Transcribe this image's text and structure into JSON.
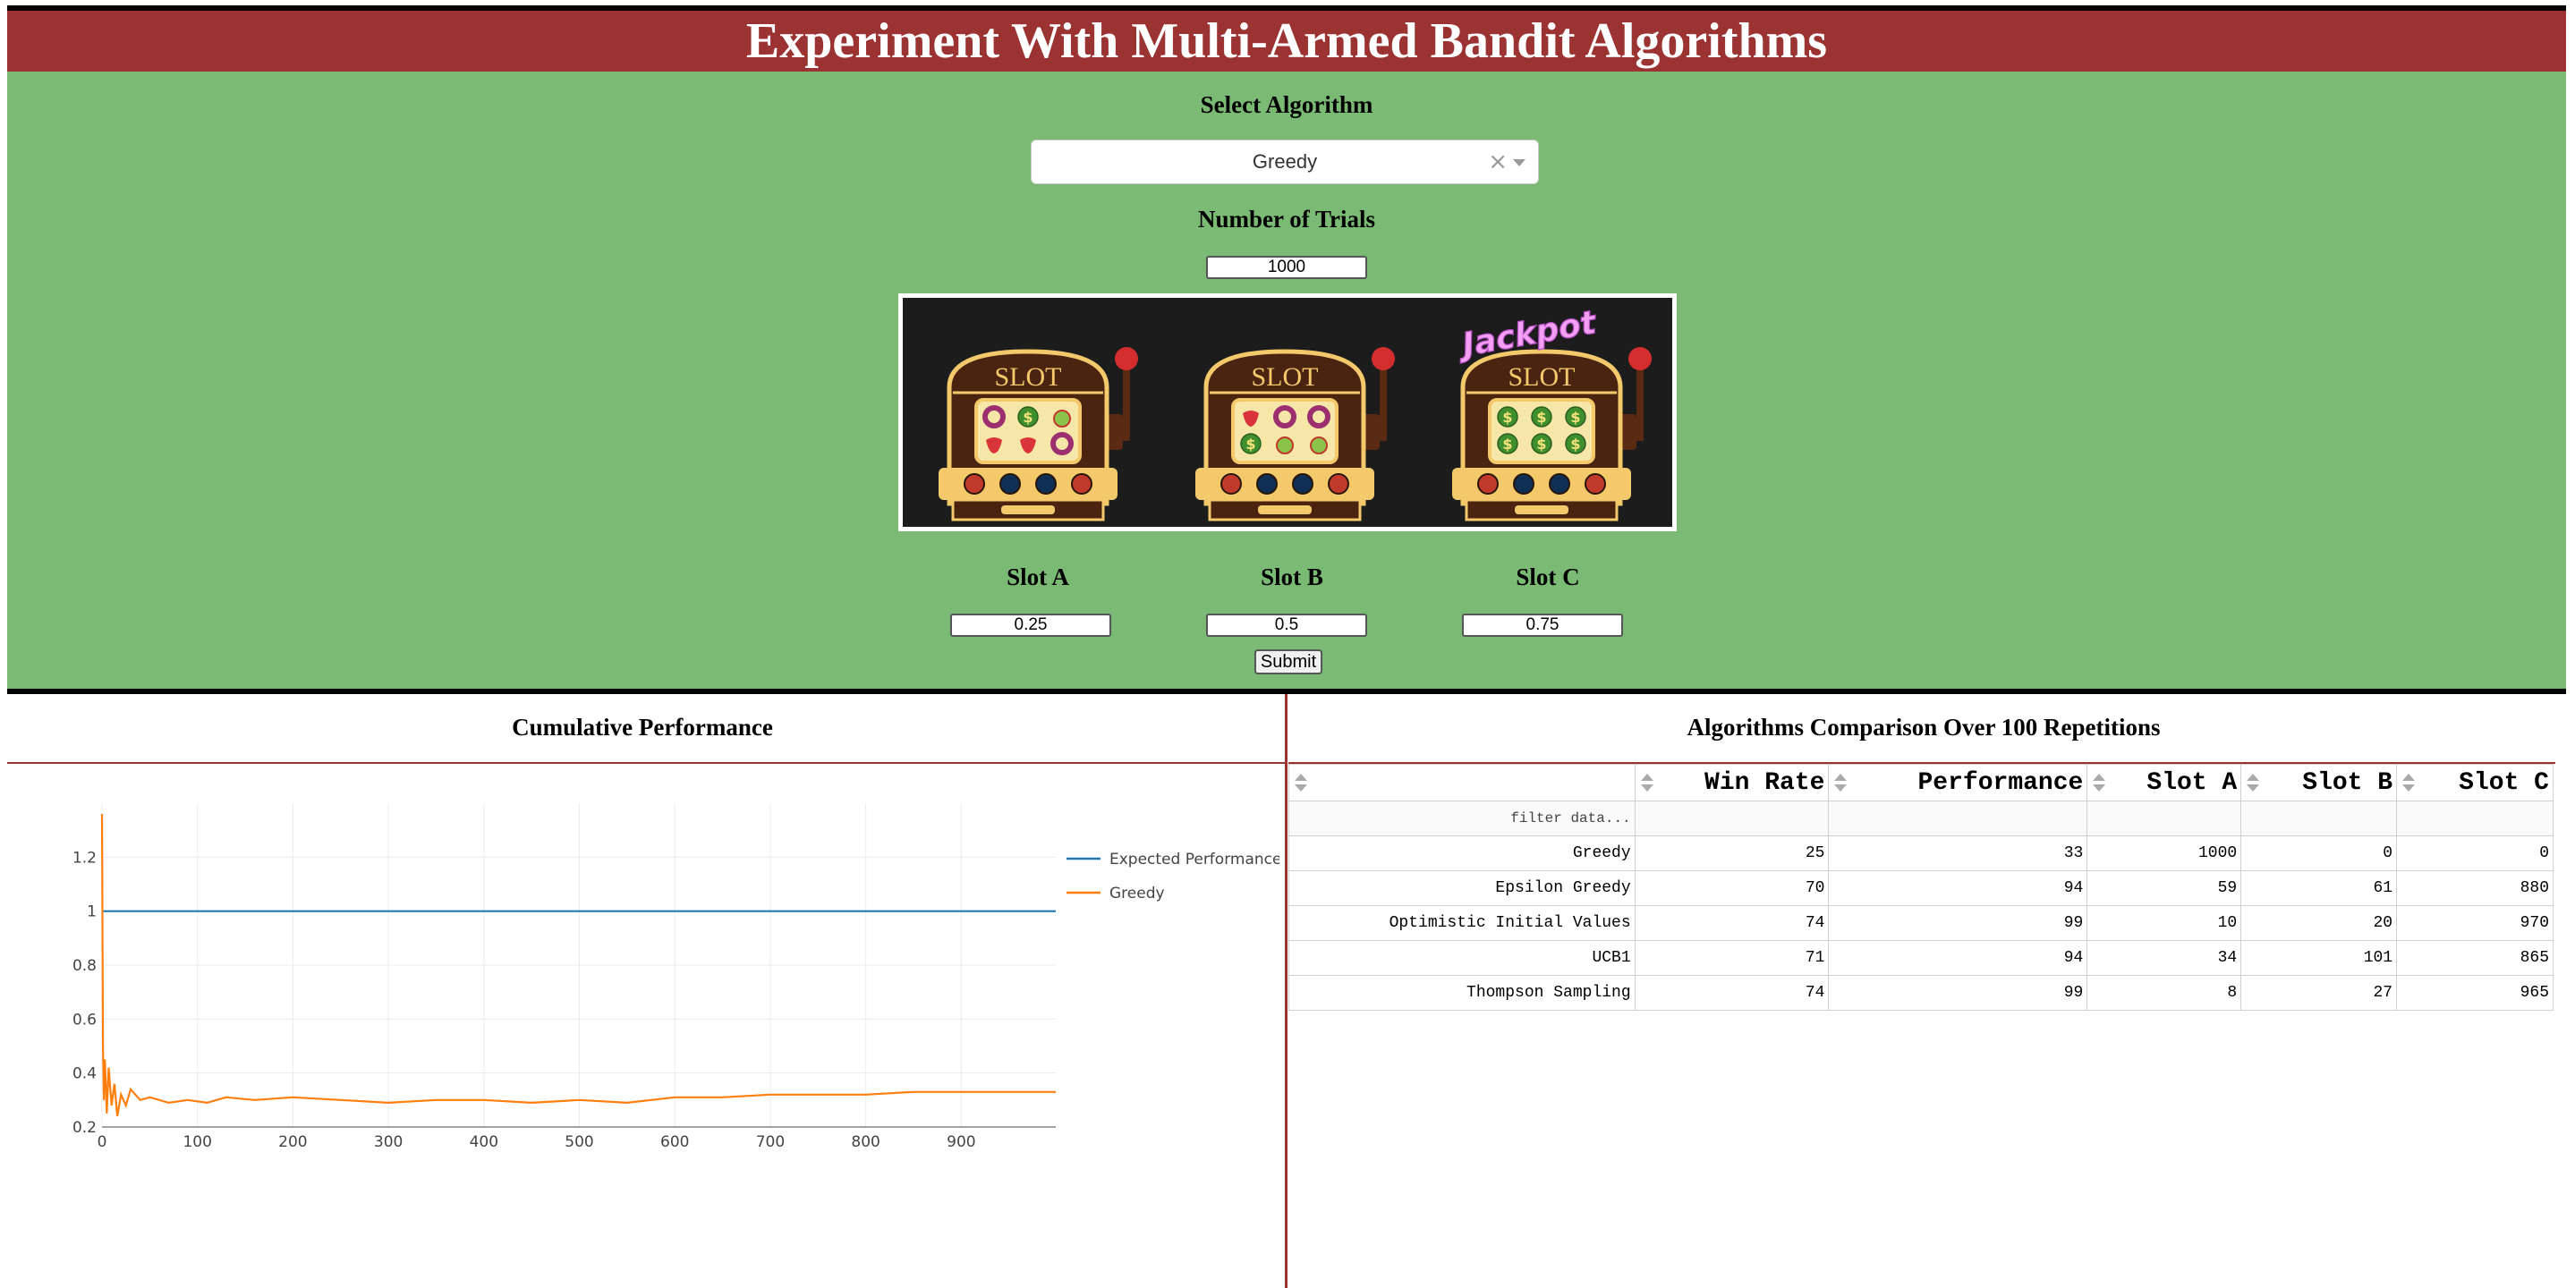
{
  "header": {
    "title": "Experiment With Multi-Armed Bandit Algorithms"
  },
  "controls": {
    "algorithm_label": "Select Algorithm",
    "algorithm_value": "Greedy",
    "algorithm_clear": "×",
    "trials_label": "Number of Trials",
    "trials_value": "1000",
    "slot_labels": [
      "Slot A",
      "Slot B",
      "Slot C"
    ],
    "slot_values": [
      "0.25",
      "0.5",
      "0.75"
    ],
    "submit_label": "Submit",
    "image": {
      "machine_title": "SLOT",
      "jackpot_text": "Jackpot",
      "reels": [
        [
          "donut",
          "dollar",
          "apple",
          "strawberry",
          "strawberry",
          "donut"
        ],
        [
          "strawberry",
          "donut",
          "donut",
          "dollar",
          "apple",
          "apple"
        ],
        [
          "dollar",
          "dollar",
          "dollar",
          "dollar",
          "dollar",
          "dollar"
        ]
      ],
      "colors": {
        "background": "#1c1c1c",
        "cabinet": "#f3c96b",
        "lever": "#d42d2d"
      }
    }
  },
  "left_panel": {
    "title": "Cumulative Performance"
  },
  "right_panel": {
    "title": "Algorithms Comparison Over 100 Repetitions"
  },
  "chart_data": {
    "type": "line",
    "title": "",
    "xlabel": "",
    "ylabel": "",
    "xlim": [
      0,
      999
    ],
    "ylim": [
      0.2,
      1.4
    ],
    "xticks": [
      0,
      100,
      200,
      300,
      400,
      500,
      600,
      700,
      800,
      900
    ],
    "yticks": [
      0.2,
      0.4,
      0.6,
      0.8,
      1,
      1.2
    ],
    "grid": true,
    "legend_position": "right",
    "series": [
      {
        "name": "Expected Performance",
        "color": "#1f77b4",
        "x": [
          0,
          999
        ],
        "y": [
          1,
          1
        ]
      },
      {
        "name": "Greedy",
        "color": "#ff7f0e",
        "x": [
          0,
          1,
          2,
          3,
          4,
          5,
          7,
          10,
          13,
          16,
          20,
          25,
          30,
          40,
          50,
          70,
          90,
          110,
          130,
          160,
          200,
          250,
          300,
          350,
          400,
          450,
          500,
          550,
          600,
          650,
          700,
          750,
          800,
          850,
          900,
          950,
          999
        ],
        "y": [
          1.36,
          0.5,
          0.3,
          0.45,
          0.36,
          0.25,
          0.42,
          0.28,
          0.36,
          0.24,
          0.32,
          0.28,
          0.34,
          0.3,
          0.31,
          0.29,
          0.3,
          0.29,
          0.31,
          0.3,
          0.31,
          0.3,
          0.29,
          0.3,
          0.3,
          0.29,
          0.3,
          0.29,
          0.31,
          0.31,
          0.32,
          0.32,
          0.32,
          0.33,
          0.33,
          0.33,
          0.33
        ]
      }
    ]
  },
  "table": {
    "columns": [
      "",
      "Win Rate",
      "Performance",
      "Slot A",
      "Slot B",
      "Slot C"
    ],
    "filter_placeholder": "filter data...",
    "rows": [
      [
        "Greedy",
        "25",
        "33",
        "1000",
        "0",
        "0"
      ],
      [
        "Epsilon Greedy",
        "70",
        "94",
        "59",
        "61",
        "880"
      ],
      [
        "Optimistic Initial Values",
        "74",
        "99",
        "10",
        "20",
        "970"
      ],
      [
        "UCB1",
        "71",
        "94",
        "34",
        "101",
        "865"
      ],
      [
        "Thompson Sampling",
        "74",
        "99",
        "8",
        "27",
        "965"
      ]
    ]
  }
}
